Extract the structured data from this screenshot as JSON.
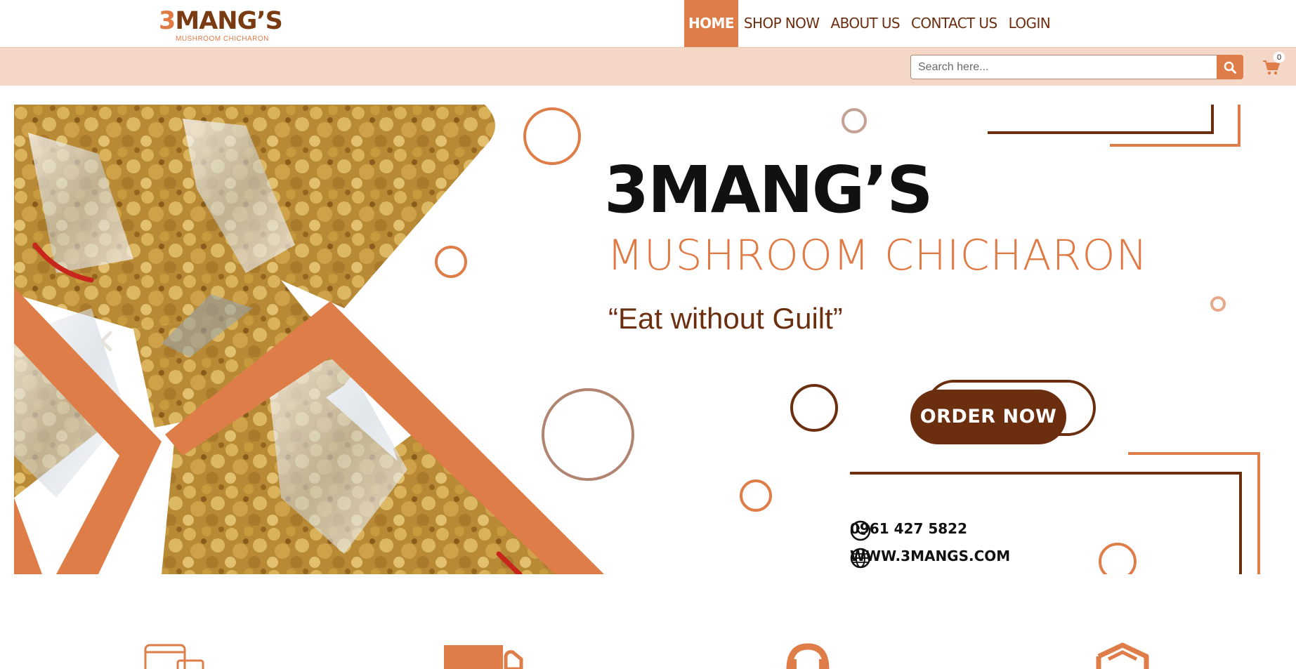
{
  "logo": {
    "main_first": "3",
    "main_rest": "MANG’S",
    "sub": "MUSHROOM CHICHARON"
  },
  "nav": {
    "items": [
      {
        "label": "HOME",
        "active": true
      },
      {
        "label": "SHOP NOW",
        "active": false
      },
      {
        "label": "ABOUT US",
        "active": false
      },
      {
        "label": "CONTACT US",
        "active": false
      },
      {
        "label": "LOGIN",
        "active": false
      }
    ]
  },
  "search": {
    "placeholder": "Search here...",
    "value": "",
    "button_icon": "search-icon"
  },
  "cart": {
    "icon": "shopping-cart-icon",
    "count": "0"
  },
  "hero": {
    "title": "3MANG’S",
    "subtitle": "MUSHROOM CHICHARON",
    "tagline": "“Eat without Guilt”",
    "cta": "ORDER NOW",
    "phone": "0961 427 5822",
    "website": "WWW.3MANGS.COM",
    "prev_icon": "chevron-left-icon"
  },
  "features": {
    "icons": [
      "mobile-order-icon",
      "cod-delivery-icon",
      "customer-support-icon",
      "secure-shield-icon"
    ]
  },
  "colors": {
    "accent": "#df7d48",
    "brown": "#6b2f10",
    "strip": "#f5d7c8",
    "food": "#c9a24a"
  }
}
